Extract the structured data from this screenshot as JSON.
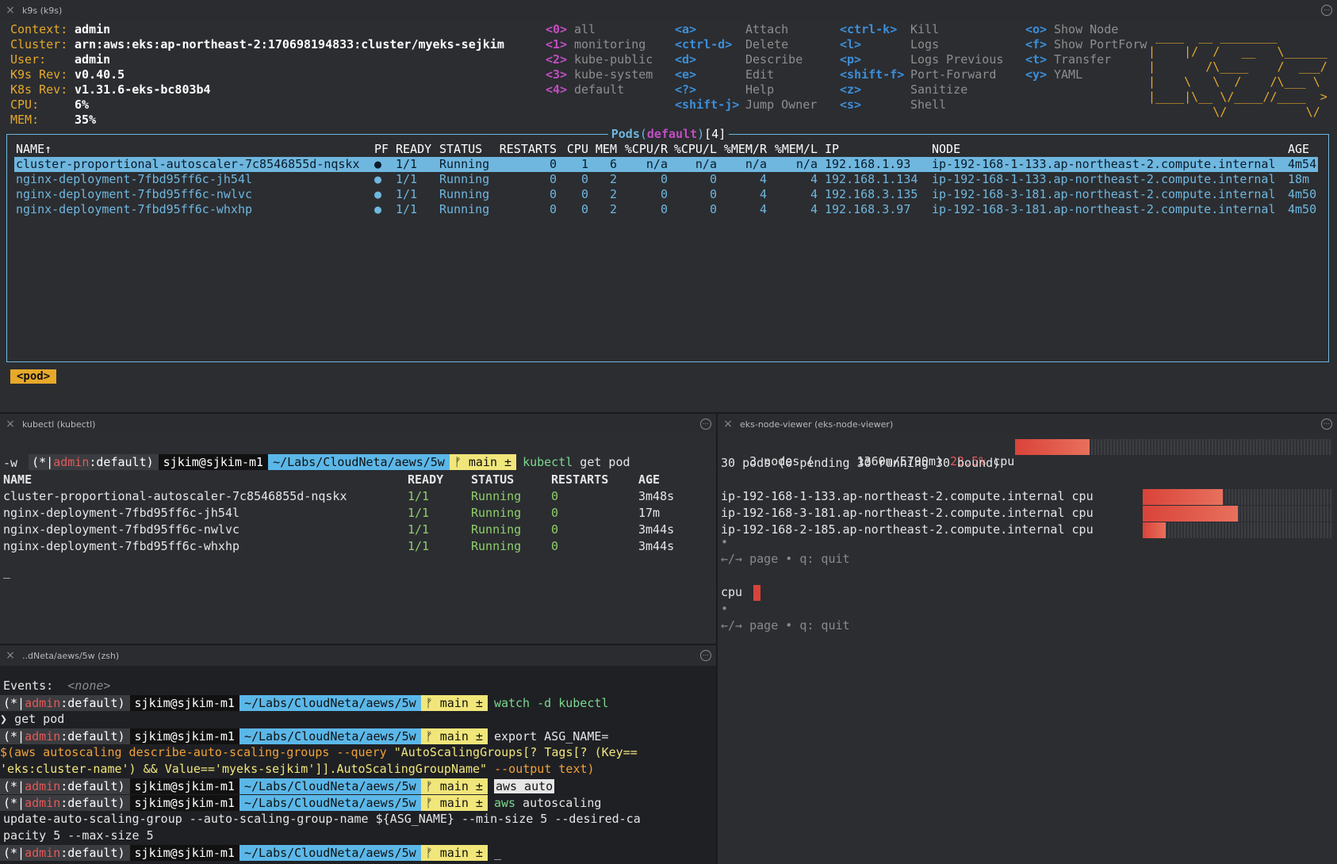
{
  "k9s": {
    "window_title": "k9s (k9s)",
    "header": [
      {
        "key": "Context:",
        "value": "admin"
      },
      {
        "key": "Cluster:",
        "value": "arn:aws:eks:ap-northeast-2:170698194833:cluster/myeks-sejkim"
      },
      {
        "key": "User:",
        "value": "admin"
      },
      {
        "key": "K9s Rev:",
        "value": "v0.40.5"
      },
      {
        "key": "K8s Rev:",
        "value": "v1.31.6-eks-bc803b4"
      },
      {
        "key": "CPU:",
        "value": "6%"
      },
      {
        "key": "MEM:",
        "value": "35%"
      }
    ],
    "namespaces": [
      {
        "key": "<0>",
        "label": "all"
      },
      {
        "key": "<1>",
        "label": "monitoring"
      },
      {
        "key": "<2>",
        "label": "kube-public"
      },
      {
        "key": "<3>",
        "label": "kube-system"
      },
      {
        "key": "<4>",
        "label": "default"
      }
    ],
    "commands_col1": [
      {
        "key": "<a>",
        "label": "Attach"
      },
      {
        "key": "<ctrl-d>",
        "label": "Delete"
      },
      {
        "key": "<d>",
        "label": "Describe"
      },
      {
        "key": "<e>",
        "label": "Edit"
      },
      {
        "key": "<?>",
        "label": "Help"
      },
      {
        "key": "<shift-j>",
        "label": "Jump Owner"
      }
    ],
    "commands_col2": [
      {
        "key": "<ctrl-k>",
        "label": "Kill"
      },
      {
        "key": "<l>",
        "label": "Logs"
      },
      {
        "key": "<p>",
        "label": "Logs Previous"
      },
      {
        "key": "<shift-f>",
        "label": "Port-Forward"
      },
      {
        "key": "<z>",
        "label": "Sanitize"
      },
      {
        "key": "<s>",
        "label": "Shell"
      }
    ],
    "commands_col3": [
      {
        "key": "<o>",
        "label": "Show Node"
      },
      {
        "key": "<f>",
        "label": "Show PortForw"
      },
      {
        "key": "<t>",
        "label": "Transfer"
      },
      {
        "key": "<y>",
        "label": "YAML"
      }
    ],
    "logo_lines": [
      " ____  __ ________       ",
      "|    |/  /   __   \\______",
      "|       /\\____    /  ___/",
      "|    \\   \\  /    /\\___ \\ ",
      "|____|\\__ \\/____//____  >",
      "         \\/           \\/ "
    ],
    "table": {
      "title_prefix": "Pods",
      "title_ns": "default",
      "title_count": "[4]",
      "columns": [
        "NAME↑",
        "PF",
        "READY",
        "STATUS",
        "RESTARTS",
        "CPU",
        "MEM",
        "%CPU/R",
        "%CPU/L",
        "%MEM/R",
        "%MEM/L",
        "IP",
        "NODE",
        "AGE"
      ],
      "rows": [
        {
          "name": "cluster-proportional-autoscaler-7c8546855d-nqskx",
          "pf": "●",
          "ready": "1/1",
          "status": "Running",
          "restarts": "0",
          "cpu": "1",
          "mem": "6",
          "cpur": "n/a",
          "cpul": "n/a",
          "memr": "n/a",
          "meml": "n/a",
          "ip": "192.168.1.93",
          "node": "ip-192-168-1-133.ap-northeast-2.compute.internal",
          "age": "4m54"
        },
        {
          "name": "nginx-deployment-7fbd95ff6c-jh54l",
          "pf": "●",
          "ready": "1/1",
          "status": "Running",
          "restarts": "0",
          "cpu": "0",
          "mem": "2",
          "cpur": "0",
          "cpul": "0",
          "memr": "4",
          "meml": "4",
          "ip": "192.168.1.134",
          "node": "ip-192-168-1-133.ap-northeast-2.compute.internal",
          "age": "18m"
        },
        {
          "name": "nginx-deployment-7fbd95ff6c-nwlvc",
          "pf": "●",
          "ready": "1/1",
          "status": "Running",
          "restarts": "0",
          "cpu": "0",
          "mem": "2",
          "cpur": "0",
          "cpul": "0",
          "memr": "4",
          "meml": "4",
          "ip": "192.168.3.135",
          "node": "ip-192-168-3-181.ap-northeast-2.compute.internal",
          "age": "4m50"
        },
        {
          "name": "nginx-deployment-7fbd95ff6c-whxhp",
          "pf": "●",
          "ready": "1/1",
          "status": "Running",
          "restarts": "0",
          "cpu": "0",
          "mem": "2",
          "cpur": "0",
          "cpul": "0",
          "memr": "4",
          "meml": "4",
          "ip": "192.168.3.97",
          "node": "ip-192-168-3-181.ap-northeast-2.compute.internal",
          "age": "4m50"
        }
      ]
    },
    "crumb": "<pod>"
  },
  "kubectl": {
    "window_title": "kubectl (kubectl)",
    "prompt": {
      "ctx_prefix": "(*|",
      "ctx_user": "admin",
      "ctx_suffix": ":default)",
      "user": "sjkim@sjkim-m1",
      "path": "~/Labs/CloudNeta/aews/5w",
      "git": "ᚠ main ±"
    },
    "command": "kubectl get pod",
    "command_wrap": "-w",
    "columns": [
      "NAME",
      "READY",
      "STATUS",
      "RESTARTS",
      "AGE"
    ],
    "rows": [
      {
        "name": "cluster-proportional-autoscaler-7c8546855d-nqskx",
        "ready": "1/1",
        "status": "Running",
        "restarts": "0",
        "age": "3m48s"
      },
      {
        "name": "nginx-deployment-7fbd95ff6c-jh54l",
        "ready": "1/1",
        "status": "Running",
        "restarts": "0",
        "age": "17m"
      },
      {
        "name": "nginx-deployment-7fbd95ff6c-nwlvc",
        "ready": "1/1",
        "status": "Running",
        "restarts": "0",
        "age": "3m44s"
      },
      {
        "name": "nginx-deployment-7fbd95ff6c-whxhp",
        "ready": "1/1",
        "status": "Running",
        "restarts": "0",
        "age": "3m44s"
      }
    ],
    "cursor": "_"
  },
  "ekv": {
    "window_title": "eks-node-viewer (eks-node-viewer)",
    "summary_line1_prefix": "3 nodes (",
    "summary_line1_cpu": "1360m/5790m)",
    "summary_pct": "23.5%",
    "summary_unit": "cpu",
    "summary_fraction": 0.235,
    "summary_line2": "30 pods (0 pending 30 running 30 bound)",
    "nodes": [
      {
        "name": "ip-192-168-1-133.ap-northeast-2.compute.internal",
        "res": "cpu",
        "fraction": 0.42
      },
      {
        "name": "ip-192-168-3-181.ap-northeast-2.compute.internal",
        "res": "cpu",
        "fraction": 0.5
      },
      {
        "name": "ip-192-168-2-185.ap-northeast-2.compute.internal",
        "res": "cpu",
        "fraction": 0.12
      }
    ],
    "dot": "•",
    "pager": "←/→ page • q: quit",
    "cpu_label": "cpu",
    "dot2": "•",
    "pager2": "←/→ page • q: quit"
  },
  "zsh": {
    "window_title": "..dNeta/aews/5w (zsh)",
    "events_label": "Events:",
    "events_value": "<none>",
    "cmd1": "watch -d kubectl",
    "cmd1_wrap": "get pod",
    "cmd2": "export ASG_NAME=",
    "cmd2_line2_a": "$(aws autoscaling describe-auto-scaling-groups --query ",
    "cmd2_line2_b": "\"AutoScalingGroups[? Tags[? (Key==",
    "cmd2_line3_a": "'eks:cluster-name') && Value=='myeks-sejkim']].AutoScalingGroupName\"",
    "cmd2_line3_b": " --output text)",
    "cmd3": "aws auto",
    "cmd4_a": "aws",
    "cmd4_b": " autoscaling",
    "cmd4_line2": "update-auto-scaling-group --auto-scaling-group-name ${ASG_NAME} --min-size 5 --desired-ca",
    "cmd4_line3": "pacity 5 --max-size 5",
    "cursor": "_"
  },
  "colors": {
    "accent_orange": "#e6a92a",
    "k9s_blue": "#6fb7df",
    "magenta": "#c24ec2",
    "prompt_path": "#5bb7e8",
    "prompt_git": "#f1e67a",
    "bar_red": "#d9433a"
  }
}
